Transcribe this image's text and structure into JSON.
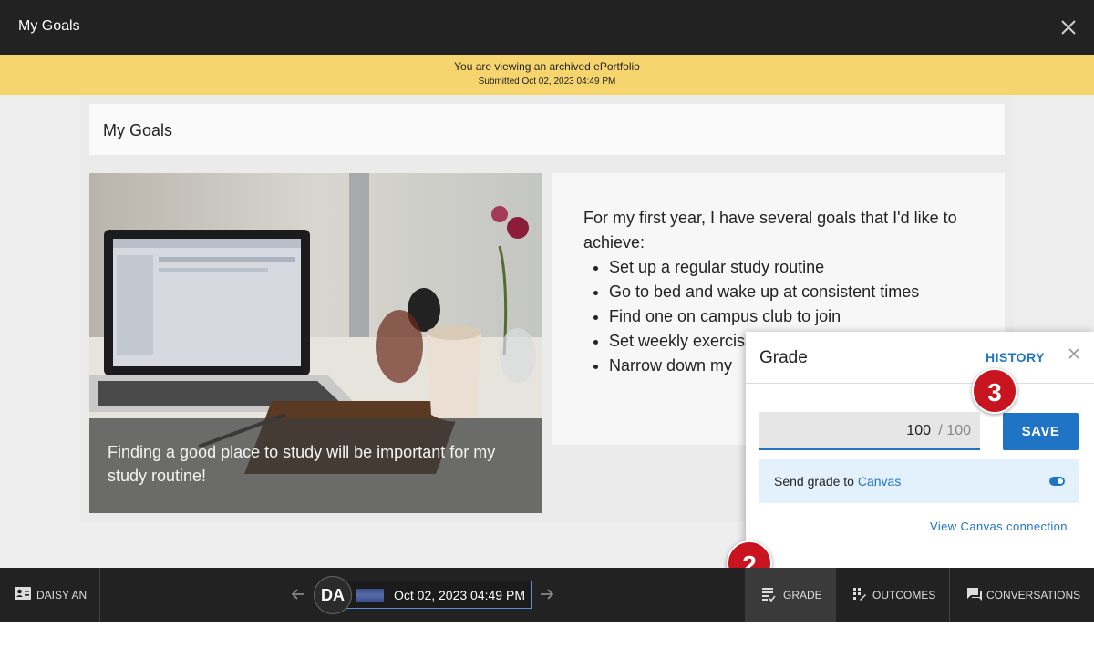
{
  "window": {
    "title": "My Goals"
  },
  "banner": {
    "line1": "You are viewing an archived ePortfolio",
    "line2": "Submitted Oct 02, 2023 04:49 PM"
  },
  "page": {
    "title": "My Goals",
    "image_caption": "Finding a good place to study will be important for my study routine!",
    "intro": "For my first year, I have several goals that I'd like to achieve:",
    "goals": [
      "Set up a regular study routine",
      "Go to bed and wake up at consistent times",
      "Find one on campus club to join",
      "Set weekly exercis",
      "Narrow down my"
    ]
  },
  "grade_panel": {
    "title": "Grade",
    "history_label": "HISTORY",
    "score": "100",
    "max_score": "/ 100",
    "save_label": "SAVE",
    "send_prefix": "Send grade to ",
    "send_link": "Canvas",
    "view_connection": "View Canvas connection",
    "toggle_on": true
  },
  "callouts": {
    "step2": "2",
    "step3": "3"
  },
  "bottom_bar": {
    "student_name": "DAISY AN",
    "avatar_initials": "DA",
    "submission_date": "Oct 02, 2023 04:49 PM",
    "tabs": {
      "grade": "GRADE",
      "outcomes": "OUTCOMES",
      "conversations": "CONVERSATIONS"
    }
  },
  "colors": {
    "accent": "#1f74c6",
    "banner": "#f6d56e",
    "callout": "#c8141e",
    "bar": "#222222"
  }
}
